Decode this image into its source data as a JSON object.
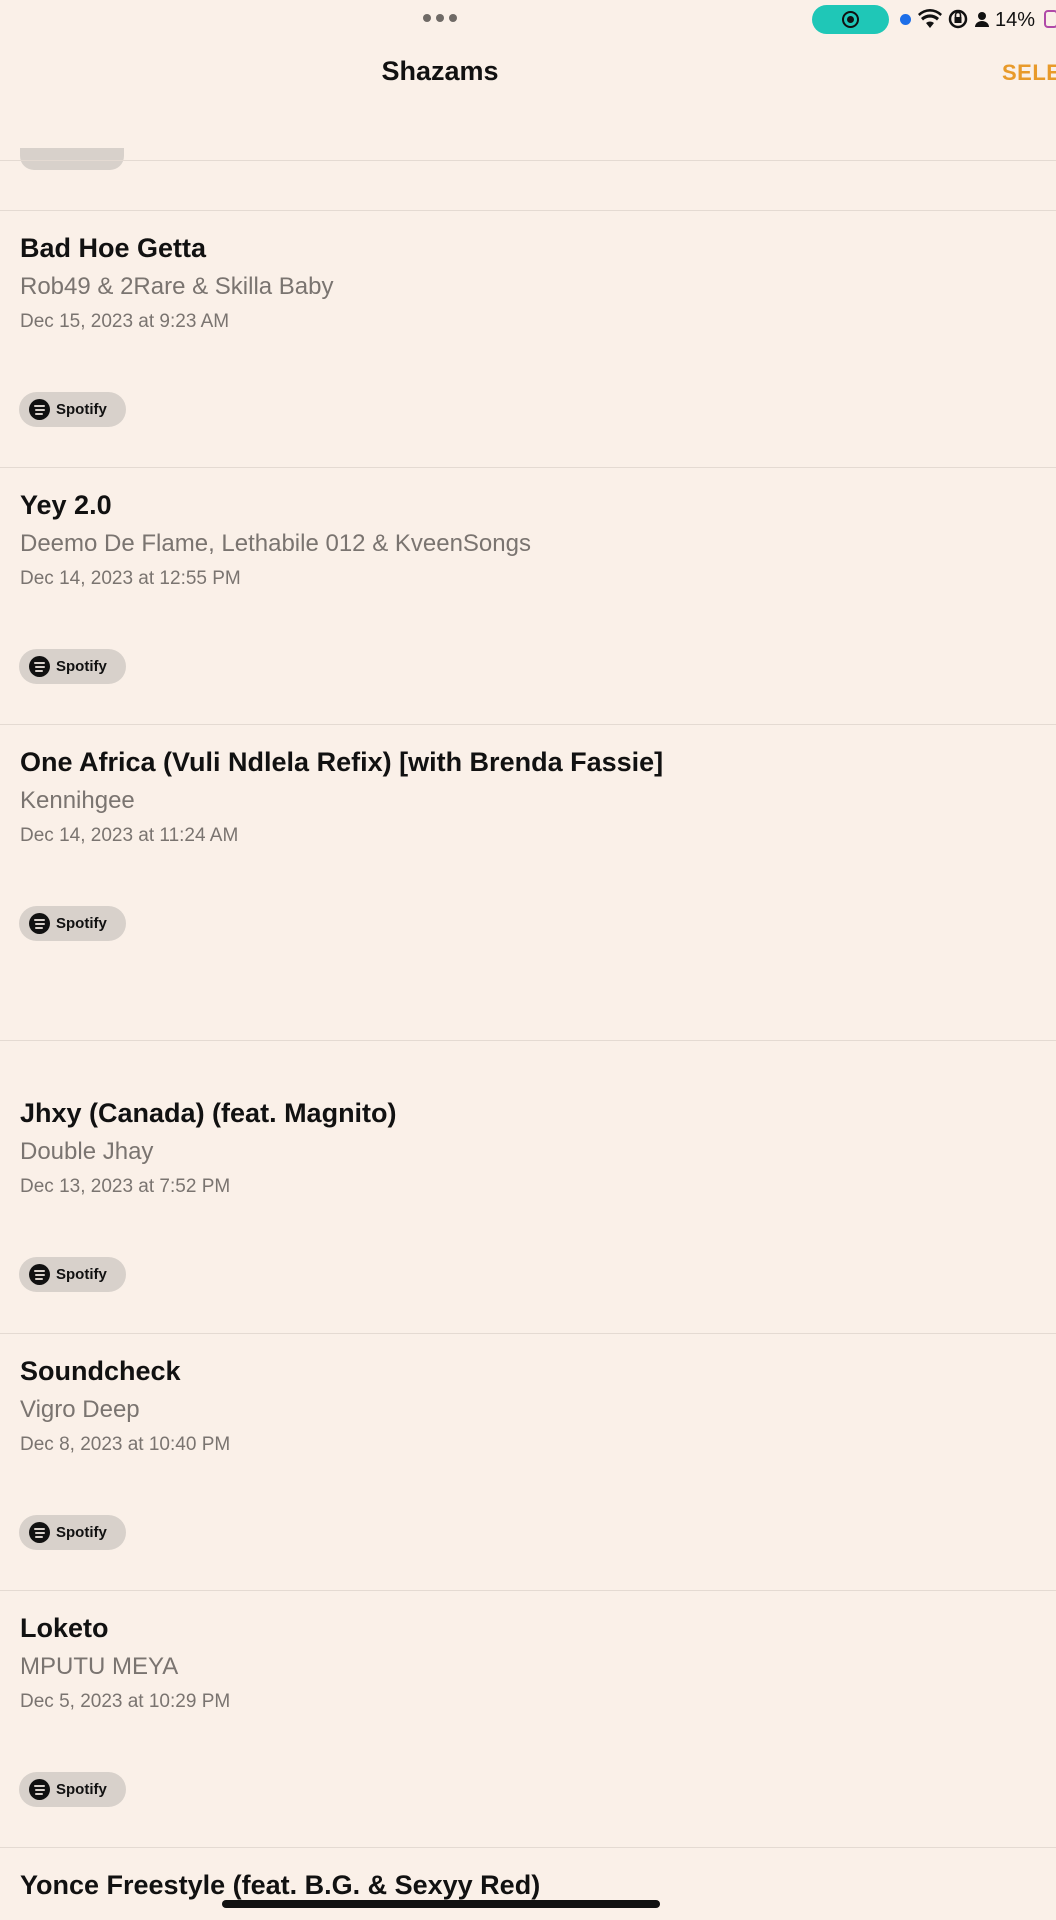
{
  "status": {
    "battery": "14%",
    "icons": [
      "more-dots-icon",
      "screen-record-icon",
      "wifi-icon",
      "orientation-lock-icon",
      "person-icon",
      "battery-icon"
    ]
  },
  "header": {
    "title": "Shazams",
    "select_label": "SELE"
  },
  "colors": {
    "background": "#faf0e8",
    "accent": "#e89a2a",
    "record_pill": "#1fc7b7"
  },
  "entries": [
    {
      "title": "Bad Hoe Getta",
      "artist": "Rob49 & 2Rare & Skilla Baby",
      "date": "Dec 15, 2023 at 9:23 AM",
      "provider": "Spotify"
    },
    {
      "title": "Yey 2.0",
      "artist": "Deemo De Flame, Lethabile 012 & KveenSongs",
      "date": "Dec 14, 2023 at 12:55 PM",
      "provider": "Spotify"
    },
    {
      "title": "One Africa (Vuli Ndlela Refix) [with Brenda Fassie]",
      "artist": "Kennihgee",
      "date": "Dec 14, 2023 at 11:24 AM",
      "provider": "Spotify"
    },
    {
      "title": "Jhxy (Canada) (feat. Magnito)",
      "artist": "Double Jhay",
      "date": "Dec 13, 2023 at 7:52 PM",
      "provider": "Spotify"
    },
    {
      "title": "Soundcheck",
      "artist": "Vigro Deep",
      "date": "Dec 8, 2023 at 10:40 PM",
      "provider": "Spotify"
    },
    {
      "title": "Loketo",
      "artist": "MPUTU MEYA",
      "date": "Dec 5, 2023 at 10:29 PM",
      "provider": "Spotify"
    },
    {
      "title": "Yonce Freestyle (feat. B.G. & Sexyy Red)",
      "artist": "",
      "date": "",
      "provider": ""
    }
  ]
}
